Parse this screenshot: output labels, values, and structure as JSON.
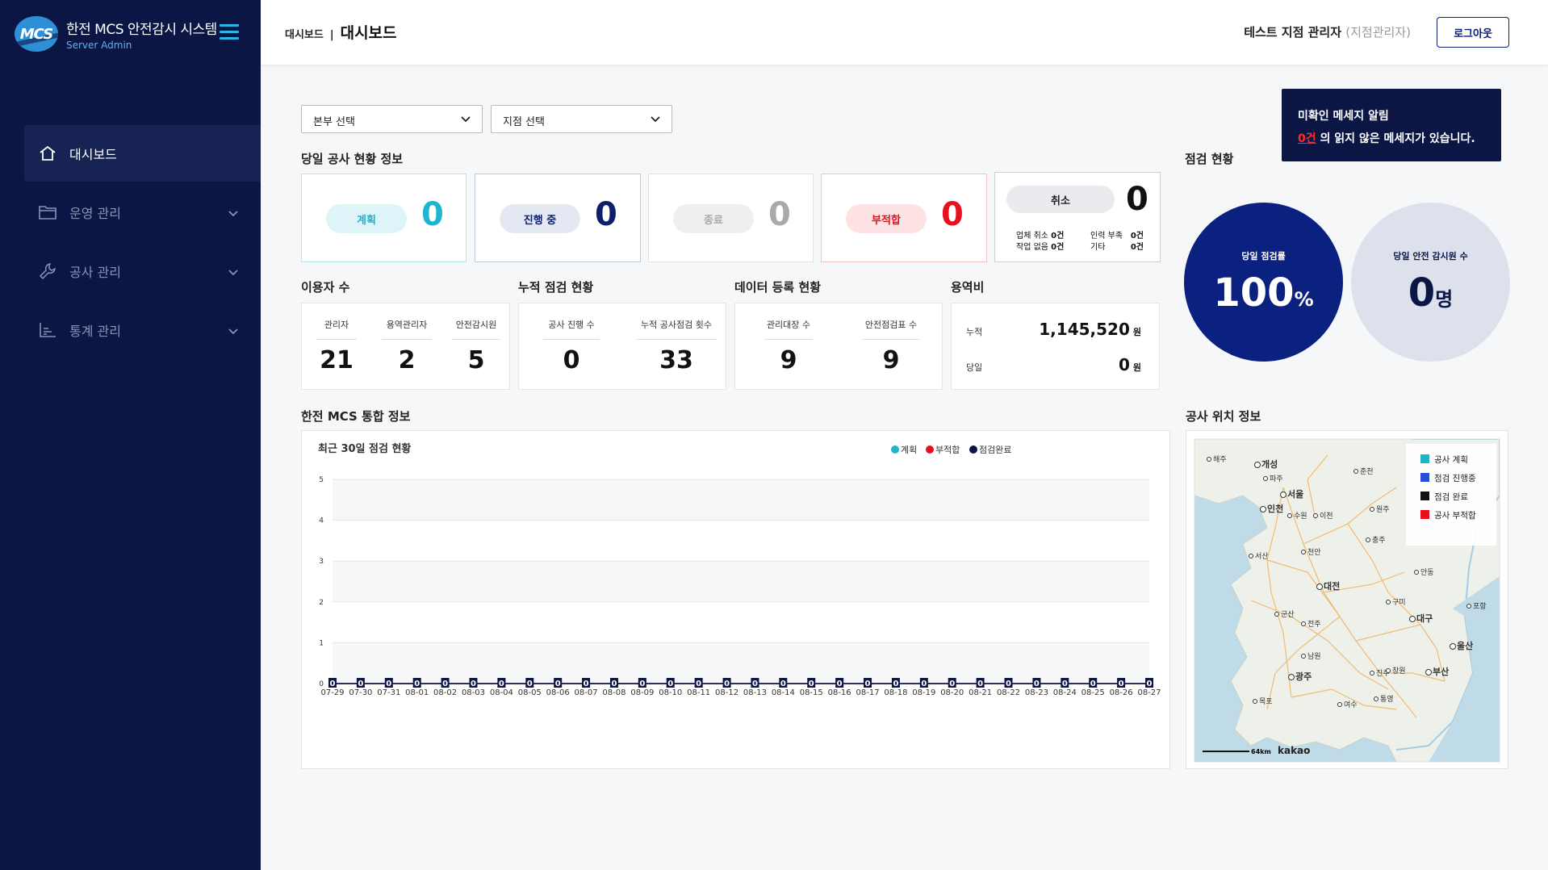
{
  "sidebar": {
    "brand_logo": "MCS",
    "brand_title": "한전 MCS 안전감시 시스템",
    "brand_sub": "Server Admin",
    "items": [
      {
        "label": "대시보드",
        "icon": "home-icon"
      },
      {
        "label": "운영 관리",
        "icon": "folder-icon"
      },
      {
        "label": "공사 관리",
        "icon": "wrench-icon"
      },
      {
        "label": "통계 관리",
        "icon": "chart-icon"
      }
    ]
  },
  "header": {
    "crumb": "대시보드",
    "sep": "|",
    "title": "대시보드",
    "user_name": "테스트 지점 관리자",
    "user_role": "(지점관리자)",
    "logout": "로그아웃"
  },
  "alert": {
    "title": "미확인 메세지 알림",
    "count": "0건",
    "suffix": " 의 읽지 않은 메세지가 있습니다."
  },
  "filters": {
    "hq": "본부 선택",
    "branch": "지점 선택"
  },
  "sections": {
    "today": "당일 공사 현황 정보",
    "inspect_status": "점검 현황",
    "users": "이용자 수",
    "cumulative": "누적 점검 현황",
    "data_reg": "데이터 등록 현황",
    "fee": "용역비",
    "integrated": "한전 MCS 통합 정보",
    "location": "공사 위치 정보"
  },
  "today_status": [
    {
      "label": "계획",
      "value": "0"
    },
    {
      "label": "진행 중",
      "value": "0"
    },
    {
      "label": "종료",
      "value": "0"
    },
    {
      "label": "부적합",
      "value": "0"
    }
  ],
  "cancel": {
    "label": "취소",
    "value": "0",
    "d1k": "업체 취소",
    "d1v": "0건",
    "d2k": "인력 부족",
    "d2v": "0건",
    "d3k": "작업 없음",
    "d3v": "0건",
    "d4k": "기타",
    "d4v": "0건"
  },
  "users": [
    {
      "label": "관리자",
      "value": "21"
    },
    {
      "label": "용역관리자",
      "value": "2"
    },
    {
      "label": "안전감시원",
      "value": "5"
    }
  ],
  "cumulative": [
    {
      "label": "공사 진행 수",
      "value": "0"
    },
    {
      "label": "누적 공사점검 횟수",
      "value": "33"
    }
  ],
  "data_reg": [
    {
      "label": "관리대장 수",
      "value": "9"
    },
    {
      "label": "안전점검표 수",
      "value": "9"
    }
  ],
  "fee": {
    "total_label": "누적",
    "total_value": "1,145,520",
    "total_unit": "원",
    "today_label": "당일",
    "today_value": "0",
    "today_unit": "원"
  },
  "inspect": {
    "rate_label": "당일 점검률",
    "rate_value": "100",
    "rate_unit": "%",
    "monitor_label": "당일 안전 감시원 수",
    "monitor_value": "0",
    "monitor_unit": "명"
  },
  "chart_data": {
    "type": "line",
    "title": "최근 30일 점검 현황",
    "categories": [
      "07-29",
      "07-30",
      "07-31",
      "08-01",
      "08-02",
      "08-03",
      "08-04",
      "08-05",
      "08-06",
      "08-07",
      "08-08",
      "08-09",
      "08-10",
      "08-11",
      "08-12",
      "08-13",
      "08-14",
      "08-15",
      "08-16",
      "08-17",
      "08-18",
      "08-19",
      "08-20",
      "08-21",
      "08-22",
      "08-23",
      "08-24",
      "08-25",
      "08-26",
      "08-27"
    ],
    "series": [
      {
        "name": "계획",
        "color": "#1fb5d1",
        "values": [
          0,
          0,
          0,
          0,
          0,
          0,
          0,
          0,
          0,
          0,
          0,
          0,
          0,
          0,
          0,
          0,
          0,
          0,
          0,
          0,
          0,
          0,
          0,
          0,
          0,
          0,
          0,
          0,
          0,
          0
        ]
      },
      {
        "name": "부적합",
        "color": "#e8101f",
        "values": [
          0,
          0,
          0,
          0,
          0,
          0,
          0,
          0,
          0,
          0,
          0,
          0,
          0,
          0,
          0,
          0,
          0,
          0,
          0,
          0,
          0,
          0,
          0,
          0,
          0,
          0,
          0,
          0,
          0,
          0
        ]
      },
      {
        "name": "점검완료",
        "color": "#0b1645",
        "values": [
          0,
          0,
          0,
          0,
          0,
          0,
          0,
          0,
          0,
          0,
          0,
          0,
          0,
          0,
          0,
          0,
          0,
          0,
          0,
          0,
          0,
          0,
          0,
          0,
          0,
          0,
          0,
          0,
          0,
          0
        ]
      }
    ],
    "ylim": [
      0,
      5
    ],
    "yticks": [
      "0",
      "1",
      "2",
      "3",
      "4",
      "5"
    ],
    "grid": true,
    "legend": "top-right"
  },
  "map": {
    "legend": [
      {
        "label": "공사 계획",
        "color": "#1fb5c8"
      },
      {
        "label": "점검 진행중",
        "color": "#2a4fd6"
      },
      {
        "label": "점검 완료",
        "color": "#111111"
      },
      {
        "label": "공사 부적합",
        "color": "#e8101f"
      }
    ],
    "cities": [
      "해주",
      "개성",
      "파주",
      "춘천",
      "서울",
      "인천",
      "수원",
      "이천",
      "원주",
      "충주",
      "서산",
      "천안",
      "안동",
      "대전",
      "구미",
      "포항",
      "군산",
      "전주",
      "대구",
      "울산",
      "남원",
      "광주",
      "진주",
      "창원",
      "부산",
      "목포",
      "통영",
      "여수"
    ],
    "scale": "64km",
    "provider": "kakao"
  }
}
